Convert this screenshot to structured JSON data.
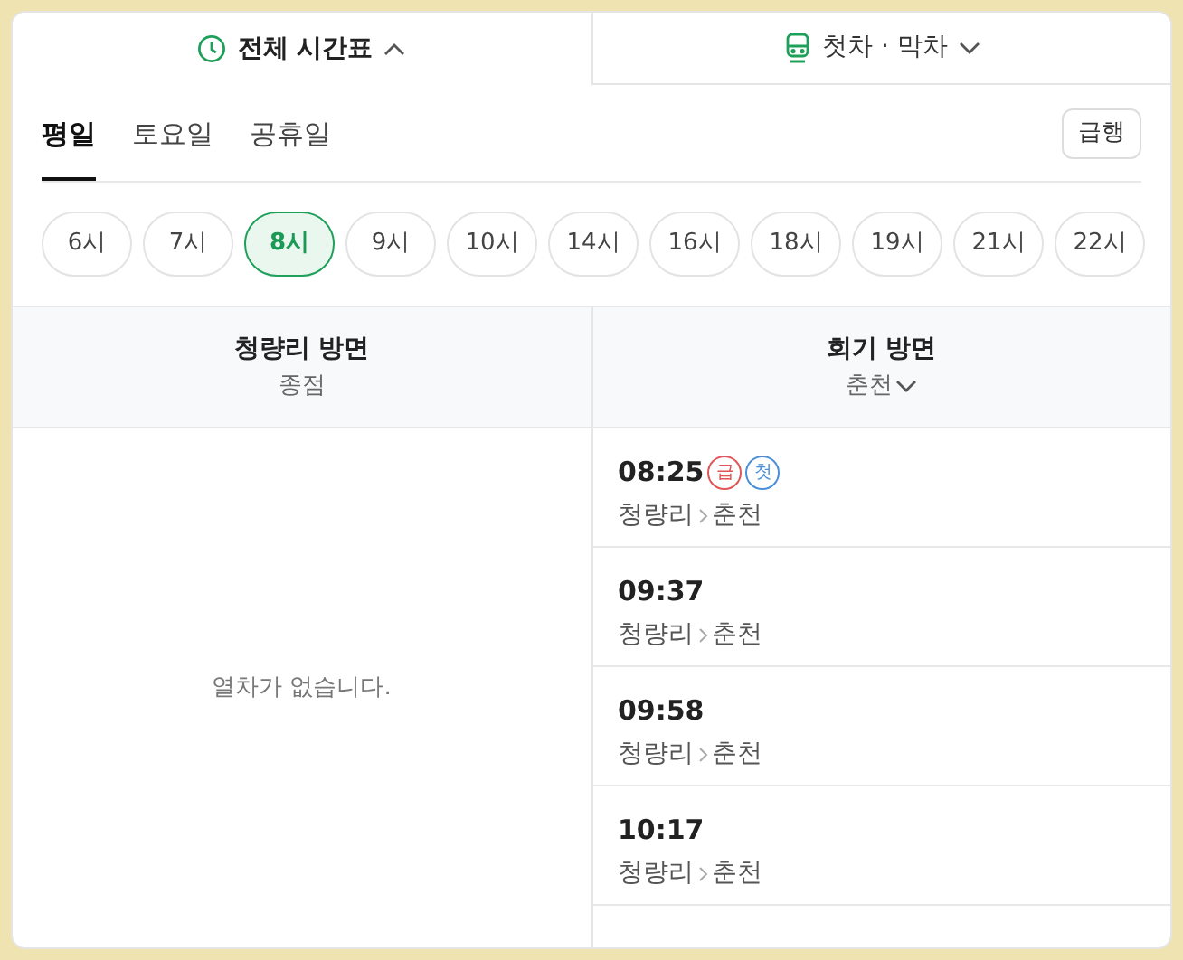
{
  "top_tabs": [
    {
      "label": "전체 시간표",
      "kind": "all",
      "selected": true,
      "expanded": true
    },
    {
      "label": "첫차 · 막차",
      "kind": "first_last",
      "selected": false,
      "expanded": false
    }
  ],
  "day_tabs": [
    {
      "label": "평일",
      "selected": true
    },
    {
      "label": "토요일",
      "selected": false
    },
    {
      "label": "공휴일",
      "selected": false
    }
  ],
  "express_button": "급행",
  "hours": [
    {
      "label": "6시",
      "selected": false
    },
    {
      "label": "7시",
      "selected": false
    },
    {
      "label": "8시",
      "selected": true
    },
    {
      "label": "9시",
      "selected": false
    },
    {
      "label": "10시",
      "selected": false
    },
    {
      "label": "14시",
      "selected": false
    },
    {
      "label": "16시",
      "selected": false
    },
    {
      "label": "18시",
      "selected": false
    },
    {
      "label": "19시",
      "selected": false
    },
    {
      "label": "21시",
      "selected": false
    },
    {
      "label": "22시",
      "selected": false
    }
  ],
  "columns": [
    {
      "title": "청량리 방면",
      "subtitle": "종점",
      "has_dropdown": false,
      "empty_message": "열차가 없습니다."
    },
    {
      "title": "회기 방면",
      "subtitle": "춘천",
      "has_dropdown": true,
      "trains": [
        {
          "time": "08:25",
          "badges": [
            {
              "label": "급",
              "kind": "express"
            },
            {
              "label": "첫",
              "kind": "first"
            }
          ],
          "from": "청량리",
          "to": "춘천"
        },
        {
          "time": "09:37",
          "from": "청량리",
          "to": "춘천"
        },
        {
          "time": "09:58",
          "from": "청량리",
          "to": "춘천"
        },
        {
          "time": "10:17",
          "from": "청량리",
          "to": "춘천"
        }
      ]
    }
  ]
}
